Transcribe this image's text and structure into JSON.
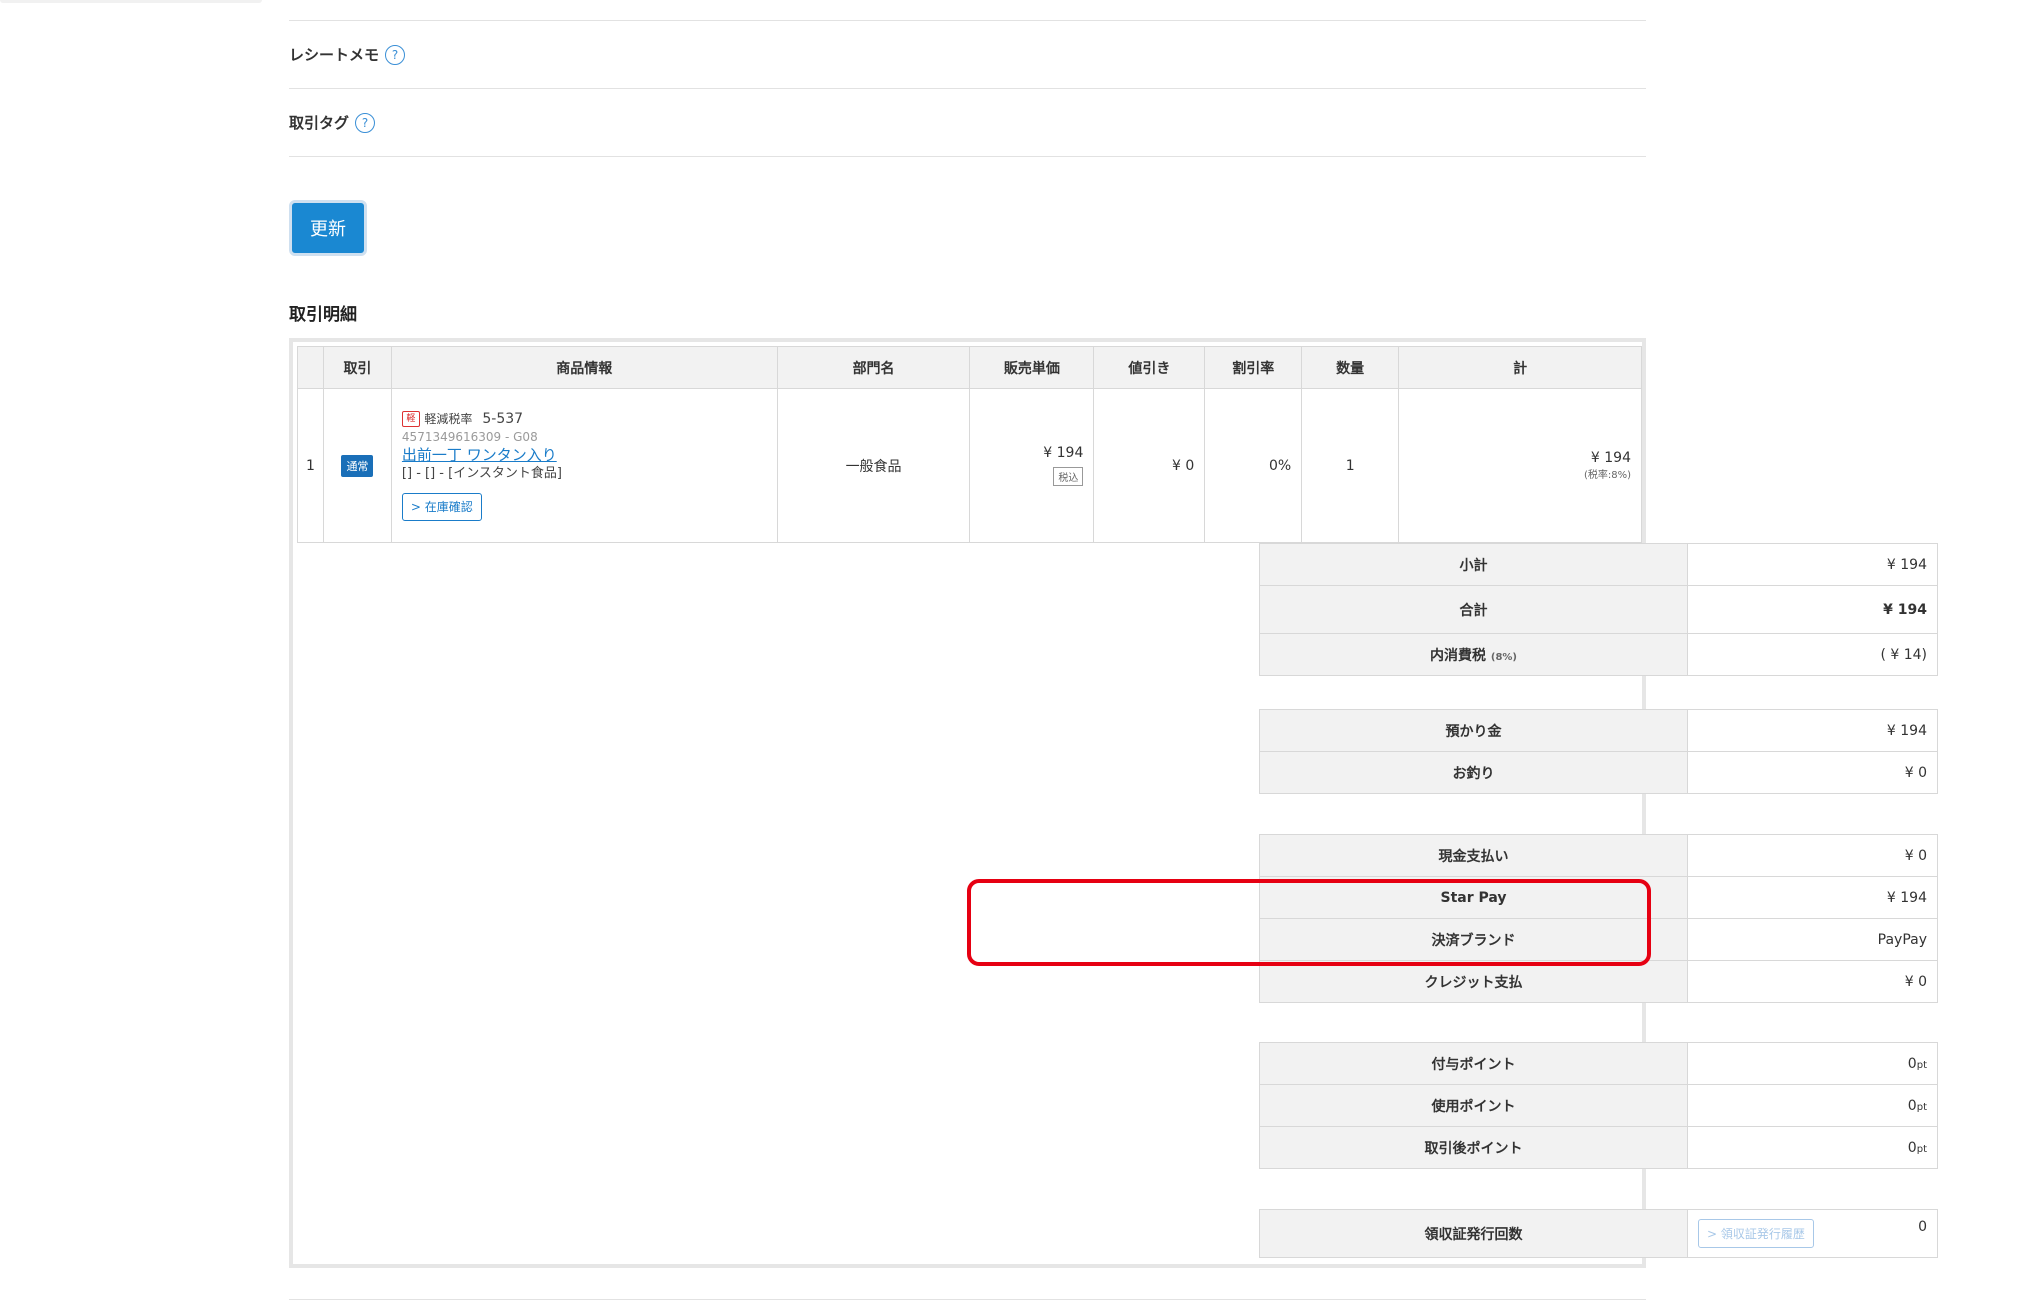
{
  "form": {
    "receipt_memo_label": "レシートメモ",
    "tag_label": "取引タグ",
    "help_glyph": "?",
    "update_label": "更新"
  },
  "detail": {
    "title": "取引明細",
    "headers": [
      "",
      "取引",
      "商品情報",
      "部門名",
      "販売単価",
      "値引き",
      "割引率",
      "数量",
      "計"
    ],
    "row": {
      "num": "1",
      "badge": "通常",
      "tax_icon": "軽",
      "tax_label": "軽減税率",
      "code": "5-537",
      "jan": "4571349616309 - G08",
      "product_name": "出前一丁 ワンタン入り",
      "category": "[] - [] - [インスタント食品]",
      "stock_button": "> 在庫確認",
      "department": "一般食品",
      "unit_price": "¥ 194",
      "tax_included": "税込",
      "discount": "¥ 0",
      "discount_rate": "0%",
      "qty": "1",
      "total": "¥ 194",
      "tax_rate": "(税率:8%)"
    }
  },
  "summary": {
    "subtotal_label": "小計",
    "subtotal": "¥ 194",
    "total_label": "合計",
    "total": "¥ 194",
    "tax_label": "内消費税",
    "tax_label_rate": "(8%)",
    "tax": "( ¥ 14)",
    "deposit_label": "預かり金",
    "deposit": "¥ 194",
    "change_label": "お釣り",
    "change": "¥ 0",
    "cash_label": "現金支払い",
    "cash": "¥ 0",
    "starpay_label": "Star Pay",
    "starpay": "¥ 194",
    "brand_label": "決済ブランド",
    "brand": "PayPay",
    "credit_label": "クレジット支払",
    "credit": "¥ 0",
    "points_given_label": "付与ポイント",
    "points_given": "0",
    "points_used_label": "使用ポイント",
    "points_used": "0",
    "points_after_label": "取引後ポイント",
    "points_after": "0",
    "pt_unit": "pt",
    "receipt_count_label": "領収証発行回数",
    "receipt_history_button": "> 領収証発行履歴",
    "receipt_count": "0"
  },
  "colors": {
    "accent": "#1a88d2",
    "highlight": "#e60012",
    "points": "#3aa83a"
  }
}
